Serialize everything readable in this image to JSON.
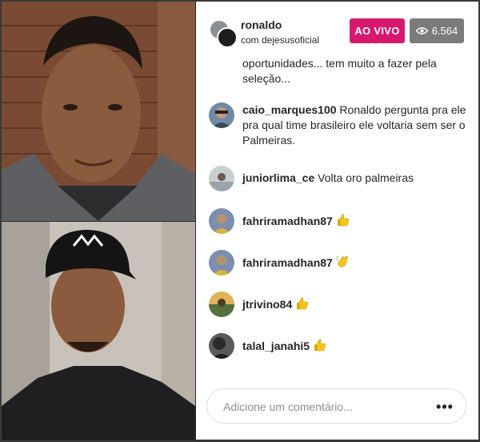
{
  "header": {
    "host": "ronaldo",
    "with_text": "com dejesusoficial",
    "live_label": "AO VIVO",
    "viewer_count": "6.564"
  },
  "comments": {
    "truncated_text": "oportunidades... tem muito a fazer pela seleção...",
    "items": [
      {
        "user": "caio_marques100",
        "text": "Ronaldo pergunta pra ele pra qual time brasileiro ele voltaria sem ser o Palmeiras.",
        "avatar_color": "#4a6a85",
        "emoji": ""
      },
      {
        "user": "juniorlima_ce",
        "text": "Volta oro palmeiras",
        "avatar_color": "#9fa6ad",
        "emoji": ""
      },
      {
        "user": "fahriramadhan87",
        "text": "",
        "avatar_color": "#6b7f9a",
        "emoji": "thumbs-up-icon"
      },
      {
        "user": "fahriramadhan87",
        "text": "",
        "avatar_color": "#6b7f9a",
        "emoji": "clapping-hands-icon"
      },
      {
        "user": "jtrivino84",
        "text": "",
        "avatar_color": "#6f8a4a",
        "emoji": "thumbs-up-icon"
      },
      {
        "user": "talal_janahi5",
        "text": "",
        "avatar_color": "#3c3c3c",
        "emoji": "thumbs-up-icon"
      }
    ]
  },
  "composer": {
    "placeholder": "Adicione um comentário...",
    "more_icon": "more-horizontal-icon"
  },
  "colors": {
    "live": "#d8186e",
    "viewers": "#7b7b7b"
  }
}
